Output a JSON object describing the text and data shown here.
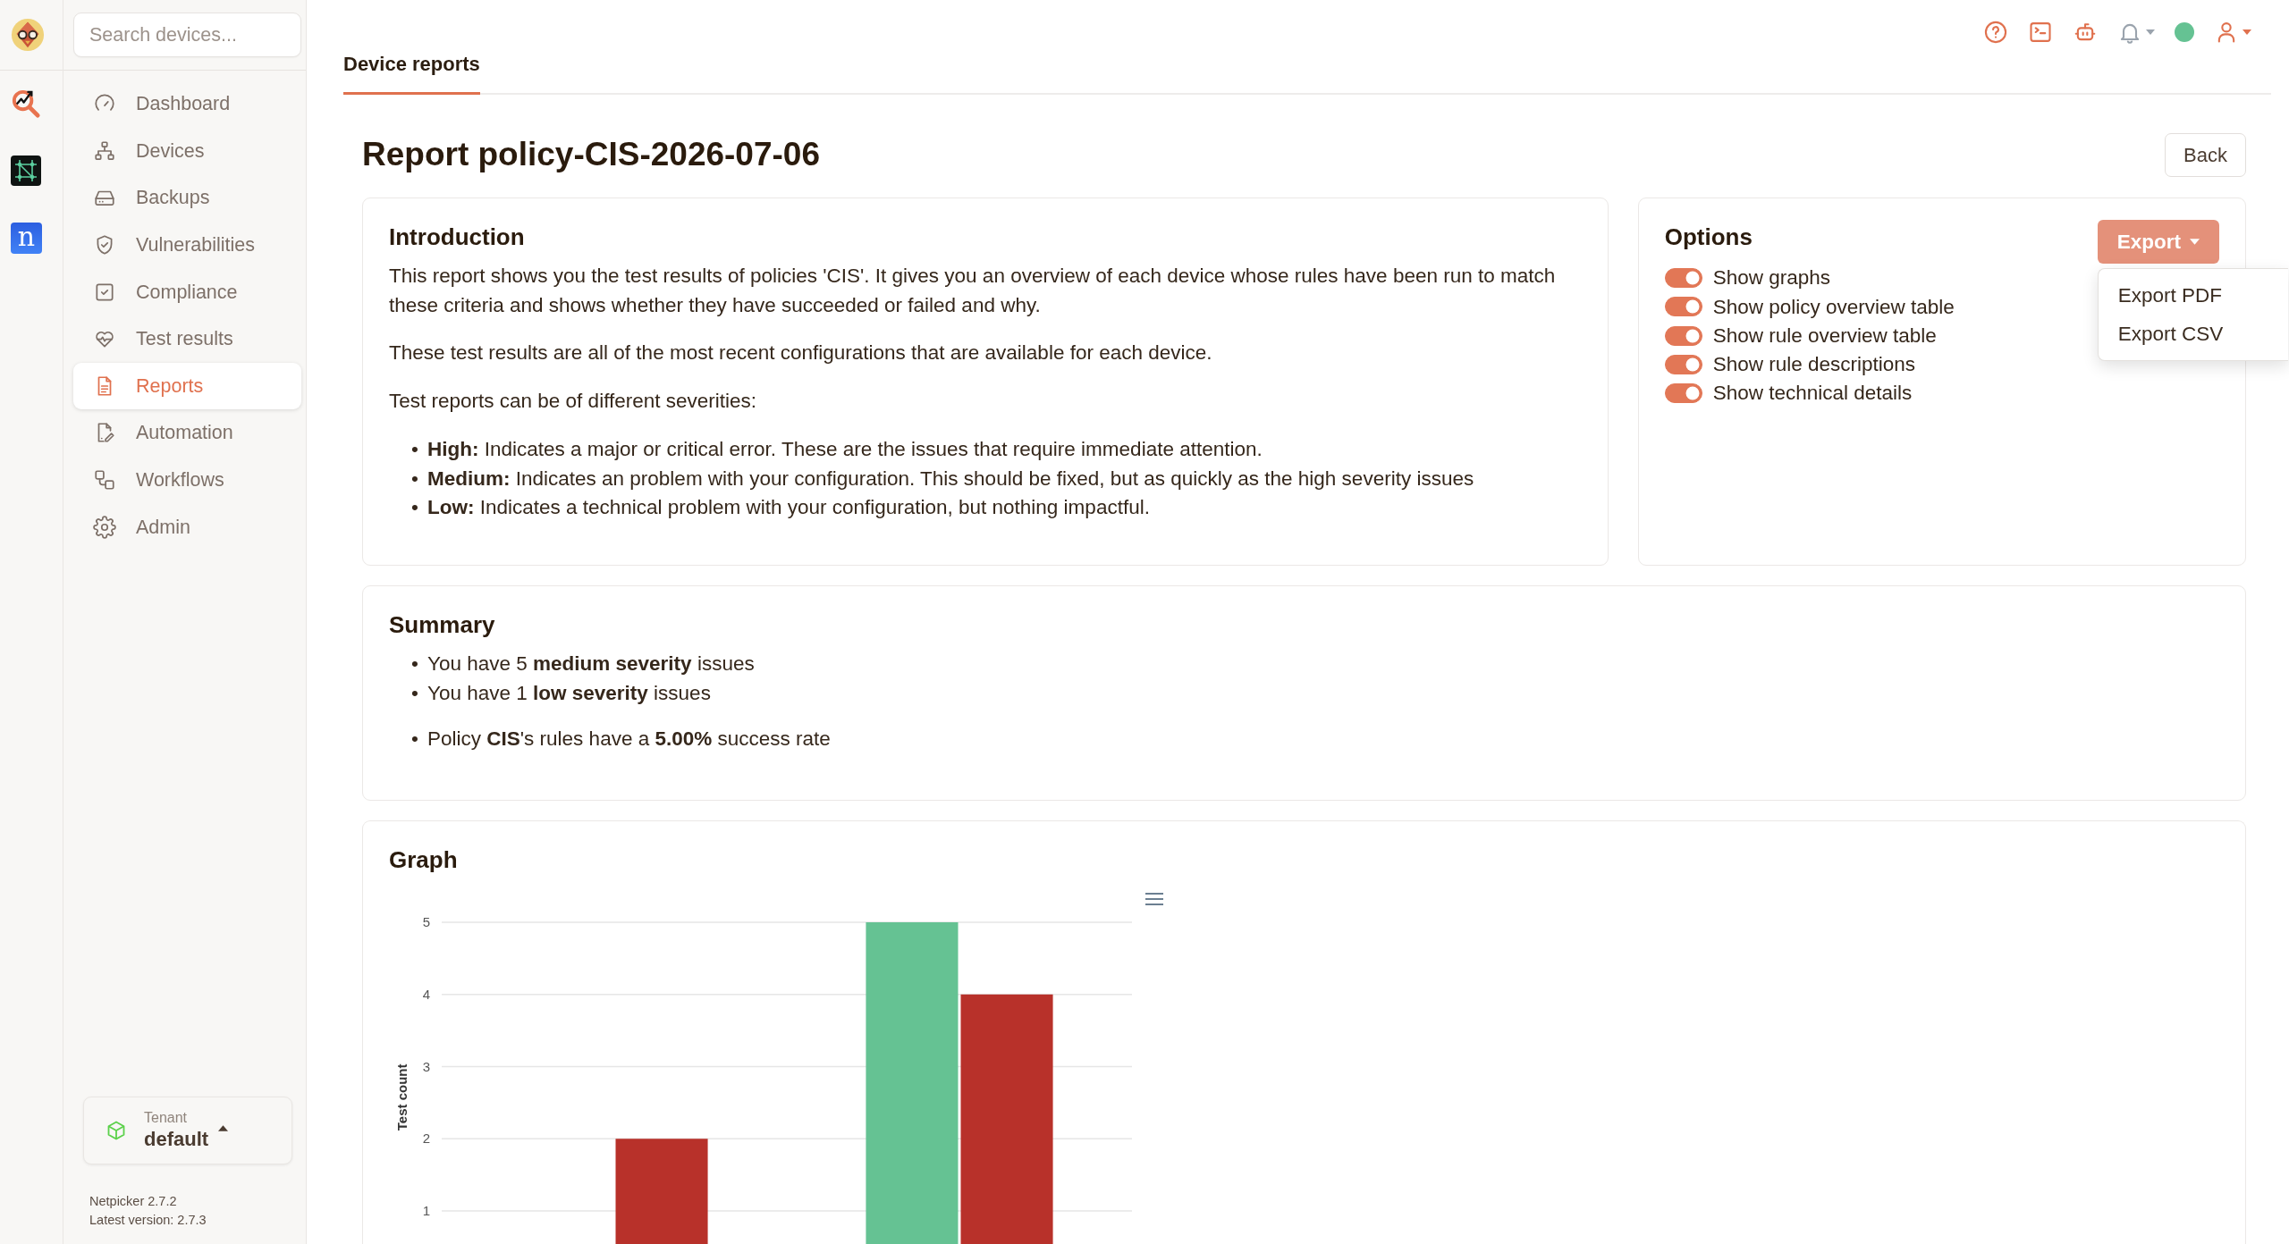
{
  "rail": {
    "letter_app": "n"
  },
  "sidebar": {
    "search": {
      "placeholder": "Search devices..."
    },
    "items": [
      {
        "label": "Dashboard",
        "selected": false
      },
      {
        "label": "Devices",
        "selected": false
      },
      {
        "label": "Backups",
        "selected": false
      },
      {
        "label": "Vulnerabilities",
        "selected": false
      },
      {
        "label": "Compliance",
        "selected": false
      },
      {
        "label": "Test results",
        "selected": false
      },
      {
        "label": "Reports",
        "selected": true
      },
      {
        "label": "Automation",
        "selected": false
      },
      {
        "label": "Workflows",
        "selected": false
      },
      {
        "label": "Admin",
        "selected": false
      }
    ],
    "tenant": {
      "label": "Tenant",
      "value": "default"
    },
    "version": "Netpicker 2.7.2",
    "latest_version": "Latest version: 2.7.3"
  },
  "tabs": [
    {
      "label": "Device reports",
      "selected": true
    }
  ],
  "page": {
    "title": "Report policy-CIS-2026-07-06",
    "back_button": "Back"
  },
  "introduction": {
    "heading": "Introduction",
    "paragraphs": [
      "This report shows you the test results of policies 'CIS'. It gives you an overview of each device whose rules have been run to match these criteria and shows whether they have succeeded or failed and why.",
      "These test results are all of the most recent configurations that are available for each device.",
      "Test reports can be of different severities:"
    ],
    "severities": [
      {
        "marker": "•",
        "text": "**High:** Indicates a major or critical error. These are the issues that require immediate attention."
      },
      {
        "marker": "•",
        "text": "**Medium:** Indicates an problem with your configuration. This should be fixed, but as quickly as the high severity issues"
      },
      {
        "marker": "•",
        "text": "**Low:** Indicates a technical problem with your configuration, but nothing impactful."
      }
    ]
  },
  "options": {
    "heading": "Options",
    "export": {
      "label": "Export",
      "expanded": true,
      "menu": [
        "Export PDF",
        "Export CSV"
      ]
    },
    "toggles": [
      {
        "label": "Show graphs",
        "on": true
      },
      {
        "label": "Show policy overview table",
        "on": true
      },
      {
        "label": "Show rule overview table",
        "on": true
      },
      {
        "label": "Show rule descriptions",
        "on": true
      },
      {
        "label": "Show technical details",
        "on": true
      }
    ]
  },
  "summary": {
    "heading": "Summary",
    "issues": [
      {
        "marker": "•",
        "text": "You have 5 **medium severity** issues"
      },
      {
        "marker": "•",
        "text": "You have 1 **low severity** issues"
      }
    ],
    "policies": [
      {
        "marker": "•",
        "text": "Policy **CIS**'s rules have a **5.00%** success rate"
      }
    ]
  },
  "graph": {
    "heading": "Graph",
    "chart_data": {
      "type": "bar",
      "ylabel": "Test count",
      "ylim": [
        0,
        5
      ],
      "yticks": [
        1,
        2,
        3,
        4,
        5
      ],
      "grid": true,
      "series": [
        {
          "color": "#65c293",
          "values": [
            0,
            5
          ]
        },
        {
          "color": "#b8312a",
          "values": [
            2,
            4
          ]
        }
      ]
    }
  }
}
